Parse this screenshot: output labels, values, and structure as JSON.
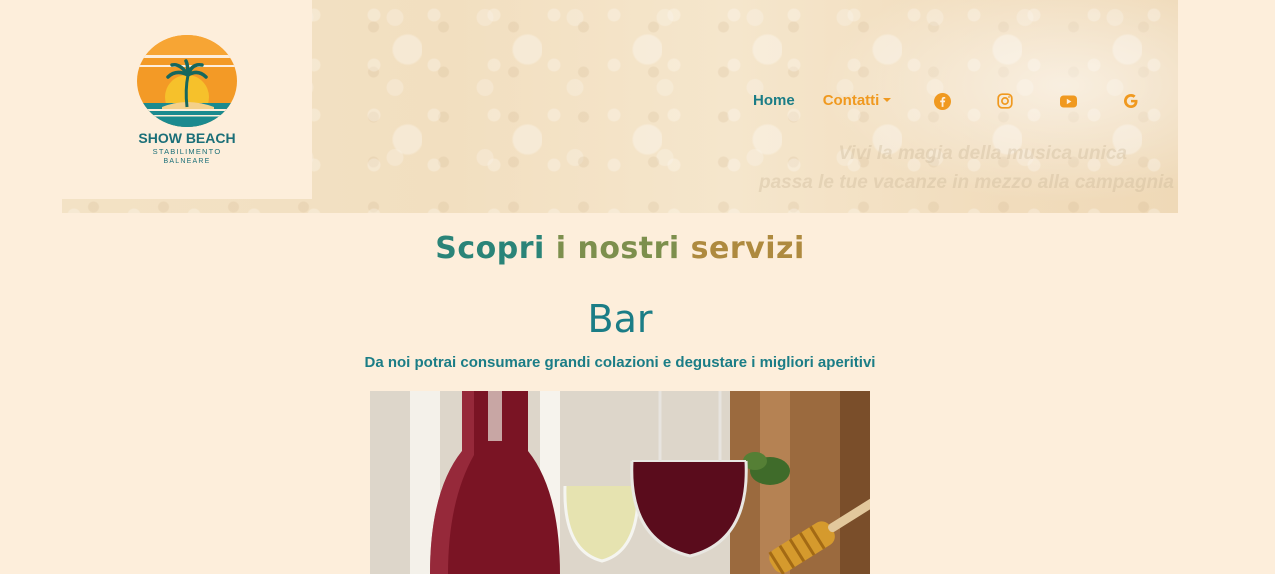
{
  "logo": {
    "name": "SHOW BEACH",
    "line1": "STABILIMENTO",
    "line2": "BALNEARE"
  },
  "nav": {
    "home": "Home",
    "contatti": "Contatti"
  },
  "social": [
    "facebook-icon",
    "instagram-icon",
    "youtube-icon",
    "google-icon"
  ],
  "hero": {
    "tagline_line1": "Vivi la magia della musica unica",
    "tagline_line2": "passa le tue vacanze in mezzo alla campagnia"
  },
  "main": {
    "section_title_w1": "Scopri",
    "section_title_w2": "i nostri",
    "section_title_w3": "servizi",
    "service_title": "Bar",
    "service_desc": "Da noi potrai consumare grandi colazioni e degustare i migliori aperitivi"
  },
  "colors": {
    "background": "#fdeedb",
    "teal": "#1b7d86",
    "orange": "#f0991f"
  }
}
